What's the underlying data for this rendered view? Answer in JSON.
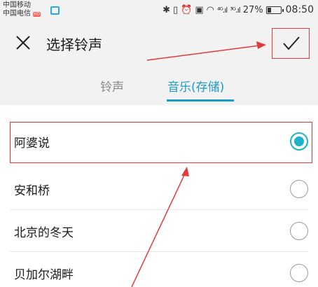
{
  "status_bar": {
    "carrier1": "中国移动",
    "carrier2": "中国电信",
    "hd_badge": "HD",
    "signal1": "⁴ᴳ.ıl",
    "signal2": "³ᴳ.ıl",
    "battery_level": 0.27,
    "battery": "27%",
    "time": "08:50"
  },
  "header": {
    "title": "选择铃声"
  },
  "tabs": {
    "ringtone": "铃声",
    "music": "音乐(存储)"
  },
  "list": {
    "items": [
      {
        "label": "阿婆说",
        "selected": true
      },
      {
        "label": "安和桥",
        "selected": false
      },
      {
        "label": "北京的冬天",
        "selected": false
      },
      {
        "label": "贝加尔湖畔",
        "selected": false
      }
    ]
  },
  "colors": {
    "accent": "#1d9ac9",
    "radio_selected": "#1fb2c9",
    "annotation": "#e03c3c"
  }
}
